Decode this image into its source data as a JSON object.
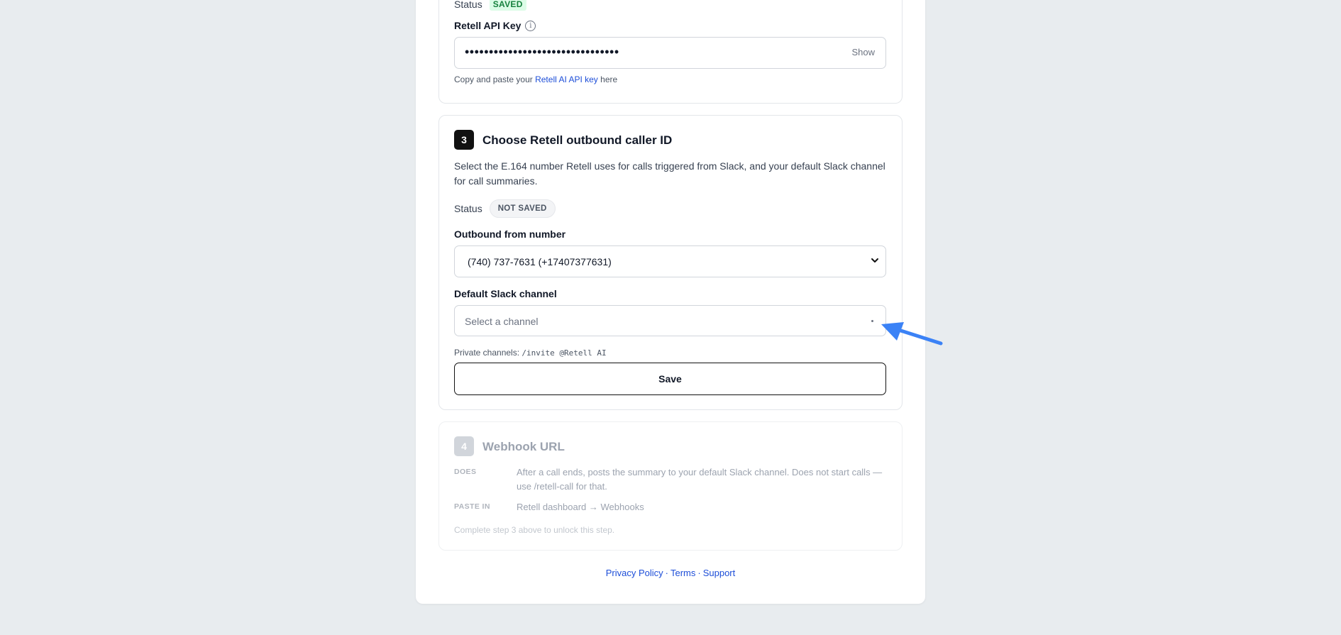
{
  "step2": {
    "status_label": "Status",
    "status_badge": "SAVED",
    "api_key_label": "Retell API Key",
    "api_key_value": "••••••••••••••••••••••••••••••••",
    "show_label": "Show",
    "help_prefix": "Copy and paste your",
    "help_link": "Retell AI API key",
    "help_suffix": "here"
  },
  "step3": {
    "number": "3",
    "title": "Choose Retell outbound caller ID",
    "description": "Select the E.164 number Retell uses for calls triggered from Slack, and your default Slack channel for call summaries.",
    "status_label": "Status",
    "status_badge": "NOT SAVED",
    "outbound_label": "Outbound from number",
    "outbound_value": "(740) 737-7631 (+17407377631)",
    "channel_label": "Default Slack channel",
    "channel_placeholder": "Select a channel",
    "private_prefix": "Private channels:",
    "private_code": "/invite @Retell AI",
    "save_label": "Save"
  },
  "step4": {
    "number": "4",
    "title": "Webhook URL",
    "does_key": "DOES",
    "does_value": "After a call ends, posts the summary to your default Slack channel. Does not start calls — use /retell-call for that.",
    "paste_key": "PASTE IN",
    "paste_value": "Retell dashboard → Webhooks",
    "locked_note": "Complete step 3 above to unlock this step."
  },
  "footer": {
    "privacy": "Privacy Policy",
    "terms": "Terms",
    "support": "Support",
    "separator": "·"
  },
  "colors": {
    "background": "#e8ecef",
    "link": "#1d4ed8",
    "saved_badge": "#dcfce7",
    "annotation_arrow": "#3b82f6"
  }
}
